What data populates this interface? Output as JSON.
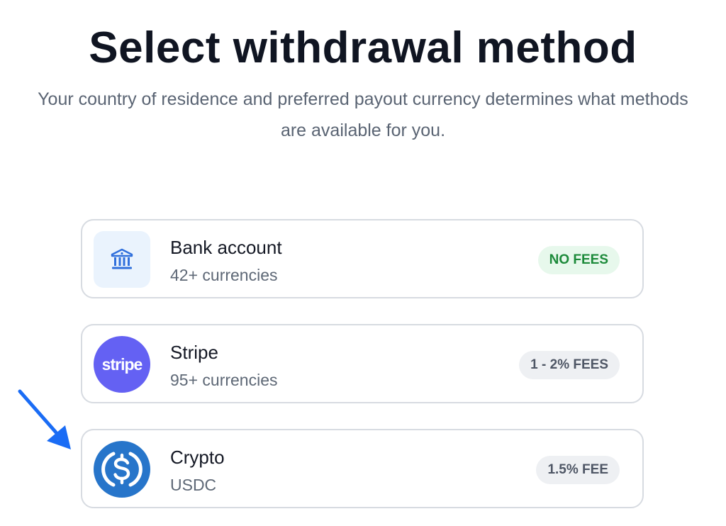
{
  "header": {
    "title": "Select withdrawal method",
    "subtitle": "Your country of residence and preferred payout currency determines what methods are available for you."
  },
  "methods": [
    {
      "name": "Bank account",
      "detail": "42+ currencies",
      "fee": "NO FEES",
      "icon": "bank-icon"
    },
    {
      "name": "Stripe",
      "detail": "95+ currencies",
      "fee": "1 - 2% FEES",
      "icon": "stripe-logo",
      "logo_text": "stripe"
    },
    {
      "name": "Crypto",
      "detail": "USDC",
      "fee": "1.5% FEE",
      "icon": "usdc-icon"
    }
  ],
  "colors": {
    "accent_blue": "#2775ca",
    "stripe_purple": "#6461f3",
    "fee_green": "#1c8a3a",
    "arrow_blue": "#1a6cf5"
  }
}
